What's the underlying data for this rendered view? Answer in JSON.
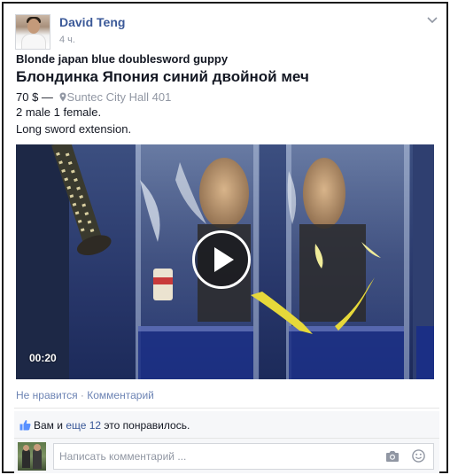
{
  "post": {
    "author": "David Teng",
    "timestamp": "4 ч.",
    "title_en": "Blonde japan blue doublesword guppy",
    "title_ru": "Блондинка Япония синий двойной меч",
    "price": "70 $",
    "separator": " — ",
    "location": "Suntec City Hall 401",
    "description_line1": "2 male 1 female.",
    "description_line2": "Long sword extension.",
    "video": {
      "duration": "00:20",
      "play_icon": "play-icon"
    }
  },
  "actions": {
    "like": "Не нравится",
    "dot": " · ",
    "comment": "Комментарий"
  },
  "likes": {
    "prefix": "Вам и ",
    "link": "еще 12",
    "suffix": " это понравилось."
  },
  "comment_box": {
    "placeholder": "Написать комментарий ...",
    "value": ""
  },
  "icons": [
    "chevron-down-icon",
    "map-pin-icon",
    "play-icon",
    "like-icon",
    "camera-icon",
    "smile-icon"
  ],
  "colors": {
    "link": "#3b5998",
    "muted": "#9197a3",
    "action": "#6d84b4",
    "panel": "#f6f7f9"
  }
}
